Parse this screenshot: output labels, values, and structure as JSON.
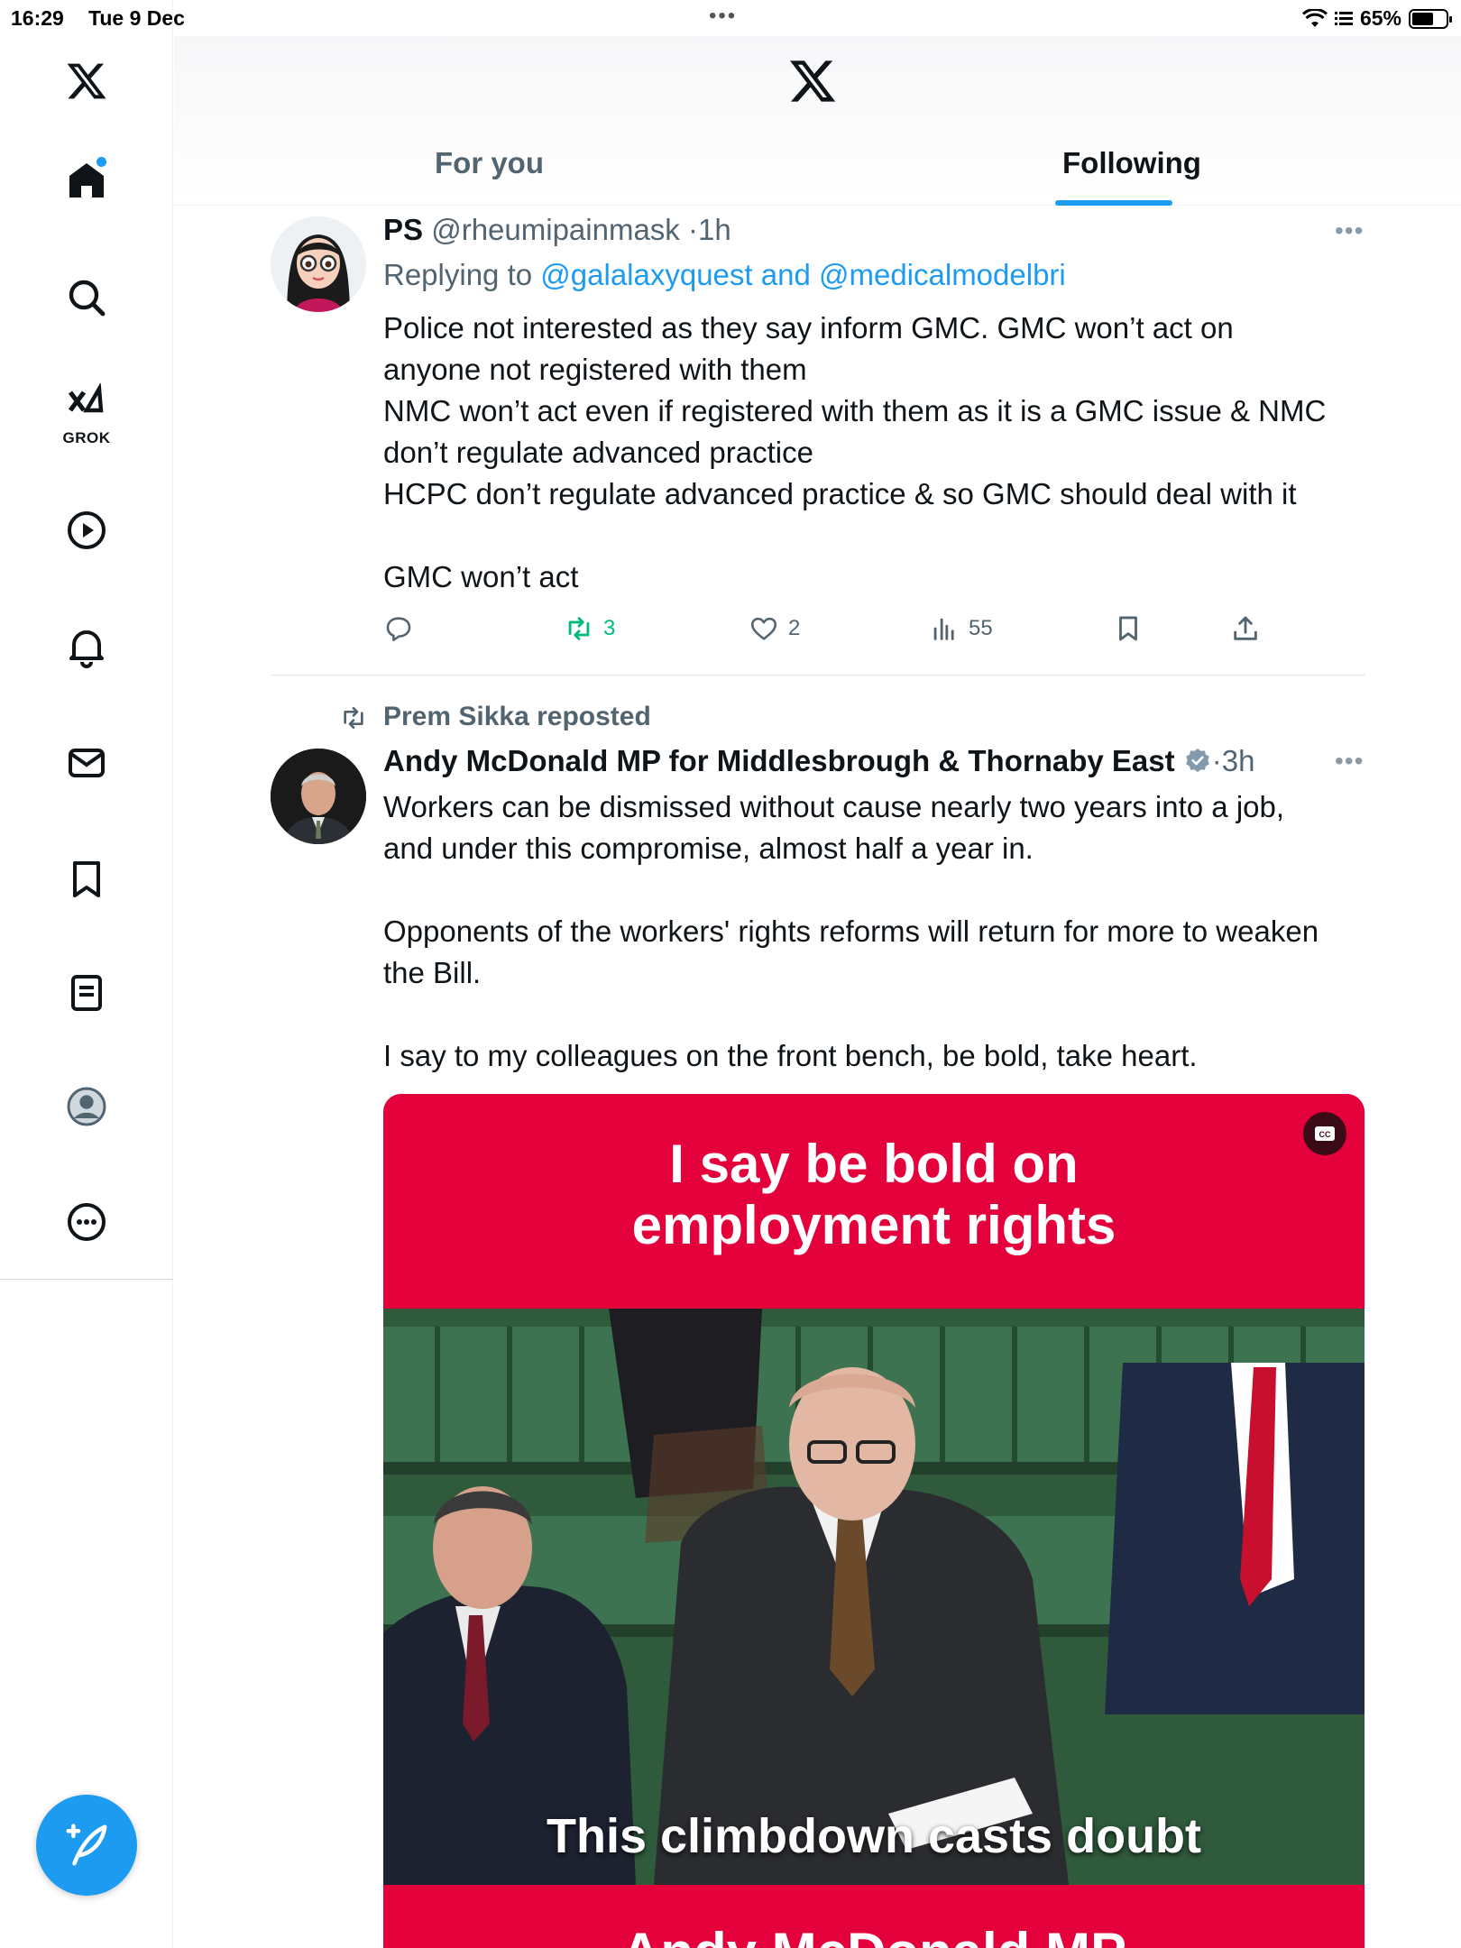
{
  "status_bar": {
    "time": "16:29",
    "date": "Tue 9 Dec",
    "battery": "65%",
    "battery_level": 0.65
  },
  "sidebar": {
    "grok_label": "GROK",
    "icons": [
      "x-logo",
      "home-icon",
      "search-icon",
      "grok-icon",
      "video-icon",
      "bell-icon",
      "mail-icon",
      "bookmark-icon",
      "lists-icon",
      "profile-icon",
      "more-icon"
    ],
    "compose_icon": "compose-icon"
  },
  "header": {
    "tabs": [
      {
        "label": "For you",
        "active": false
      },
      {
        "label": "Following",
        "active": true
      }
    ]
  },
  "colors": {
    "accent": "#1d9bf0",
    "retweet_green": "#00ba7c",
    "media_red": "#e4003b",
    "secondary_text": "#536471"
  },
  "tweets": [
    {
      "name": "PS",
      "handle": "@rheumipainmask",
      "time": "1h",
      "replying_prefix": "Replying to",
      "replying_to": "@galalaxyquest and @medicalmodelbri",
      "text_lines": [
        "Police not interested as they say inform GMC. GMC won’t act on",
        "anyone not registered with them",
        "NMC won’t act even if registered with them as it is a GMC issue & NMC",
        "don’t regulate advanced practice",
        "HCPC don’t regulate advanced practice & so GMC should deal with it",
        "",
        "GMC won’t act"
      ],
      "actions": {
        "replies": "",
        "retweets": "3",
        "likes": "2",
        "views": "55"
      }
    },
    {
      "reposted_by": "Prem Sikka reposted",
      "name": "Andy McDonald MP for Middlesbrough & Thornaby East",
      "verified": true,
      "time": "3h",
      "text_lines": [
        "Workers can be dismissed without cause nearly two years into a job,",
        "and under this compromise, almost half a year in.",
        "",
        "Opponents of the workers' rights reforms will return for more to weaken",
        "the Bill.",
        "",
        "I say to my colleagues on the front bench, be bold, take heart."
      ],
      "media": {
        "headline_line1": "I say be bold on",
        "headline_line2": "employment rights",
        "caption": "This climbdown casts doubt",
        "bottom_text": "Andy McDonald MP",
        "cc_label": "CC"
      }
    }
  ]
}
